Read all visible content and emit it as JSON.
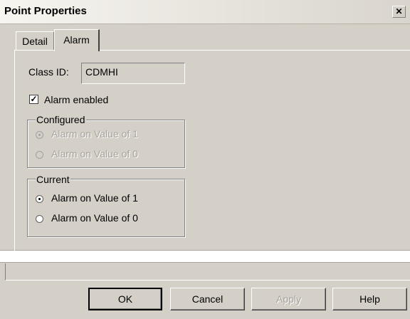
{
  "window": {
    "title": "Point Properties",
    "close_glyph": "✕"
  },
  "tabs": [
    {
      "label": "Detail"
    },
    {
      "label": "Alarm"
    }
  ],
  "alarm_tab": {
    "class_id_label": "Class ID:",
    "class_id_value": "CDMHI",
    "alarm_enabled_label": "Alarm enabled",
    "alarm_enabled": true,
    "configured": {
      "legend": "Configured",
      "options": [
        "Alarm on Value of 1",
        "Alarm on Value of 0"
      ],
      "selected": "Alarm on Value of 1",
      "disabled": true
    },
    "current": {
      "legend": "Current",
      "options": [
        "Alarm on Value of 1",
        "Alarm on Value of 0"
      ],
      "selected": "Alarm on Value of 1"
    }
  },
  "buttons": {
    "ok": "OK",
    "cancel": "Cancel",
    "apply": "Apply",
    "help": "Help"
  }
}
